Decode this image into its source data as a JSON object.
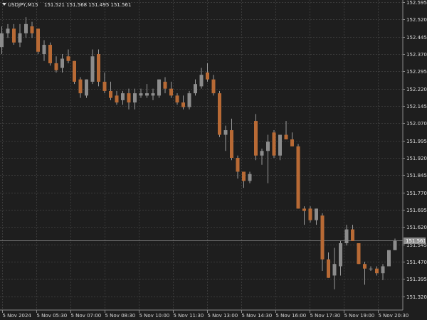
{
  "header": {
    "symbol": "USDJPY,M15",
    "ohlc": "151.521 151.568 151.495 151.561"
  },
  "colors": {
    "background": "#1e1e1e",
    "grid": "#3a3a3a",
    "axis": "#8a8a8a",
    "bull": "#8c8c8c",
    "bear": "#b86a35",
    "wick": "#9a9a9a",
    "price_tag_bg": "#8f8f8f"
  },
  "chart_data": {
    "type": "candlestick",
    "title": "",
    "grid": true,
    "ylim": [
      151.285,
      152.595
    ],
    "y_ticks": [
      "152.595",
      "152.520",
      "152.445",
      "152.370",
      "152.295",
      "152.220",
      "152.145",
      "152.070",
      "151.995",
      "151.920",
      "151.845",
      "151.770",
      "151.695",
      "151.620",
      "151.545",
      "151.470",
      "151.395",
      "151.320"
    ],
    "x_ticks": [
      "5 Nov 2024",
      "5 Nov 05:30",
      "5 Nov 07:00",
      "5 Nov 08:30",
      "5 Nov 10:00",
      "5 Nov 11:30",
      "5 Nov 13:00",
      "5 Nov 14:30",
      "5 Nov 16:00",
      "5 Nov 17:30",
      "5 Nov 19:00",
      "5 Nov 20:30"
    ],
    "current_price": "151.561",
    "candles": [
      {
        "o": 152.4,
        "h": 152.49,
        "l": 152.37,
        "c": 152.46
      },
      {
        "o": 152.46,
        "h": 152.5,
        "l": 152.44,
        "c": 152.48
      },
      {
        "o": 152.48,
        "h": 152.5,
        "l": 152.41,
        "c": 152.42
      },
      {
        "o": 152.42,
        "h": 152.5,
        "l": 152.4,
        "c": 152.46
      },
      {
        "o": 152.46,
        "h": 152.53,
        "l": 152.44,
        "c": 152.5
      },
      {
        "o": 152.49,
        "h": 152.51,
        "l": 152.44,
        "c": 152.46
      },
      {
        "o": 152.48,
        "h": 152.48,
        "l": 152.37,
        "c": 152.38
      },
      {
        "o": 152.37,
        "h": 152.43,
        "l": 152.34,
        "c": 152.41
      },
      {
        "o": 152.41,
        "h": 152.42,
        "l": 152.32,
        "c": 152.33
      },
      {
        "o": 152.33,
        "h": 152.36,
        "l": 152.29,
        "c": 152.3
      },
      {
        "o": 152.31,
        "h": 152.37,
        "l": 152.29,
        "c": 152.35
      },
      {
        "o": 152.36,
        "h": 152.39,
        "l": 152.33,
        "c": 152.34
      },
      {
        "o": 152.34,
        "h": 152.34,
        "l": 152.24,
        "c": 152.25
      },
      {
        "o": 152.26,
        "h": 152.27,
        "l": 152.18,
        "c": 152.2
      },
      {
        "o": 152.19,
        "h": 152.26,
        "l": 152.18,
        "c": 152.26
      },
      {
        "o": 152.25,
        "h": 152.39,
        "l": 152.24,
        "c": 152.36
      },
      {
        "o": 152.37,
        "h": 152.39,
        "l": 152.23,
        "c": 152.25
      },
      {
        "o": 152.25,
        "h": 152.29,
        "l": 152.2,
        "c": 152.21
      },
      {
        "o": 152.21,
        "h": 152.25,
        "l": 152.17,
        "c": 152.18
      },
      {
        "o": 152.19,
        "h": 152.21,
        "l": 152.15,
        "c": 152.16
      },
      {
        "o": 152.17,
        "h": 152.21,
        "l": 152.15,
        "c": 152.2
      },
      {
        "o": 152.2,
        "h": 152.22,
        "l": 152.13,
        "c": 152.16
      },
      {
        "o": 152.16,
        "h": 152.22,
        "l": 152.13,
        "c": 152.2
      },
      {
        "o": 152.19,
        "h": 152.22,
        "l": 152.18,
        "c": 152.2
      },
      {
        "o": 152.19,
        "h": 152.24,
        "l": 152.18,
        "c": 152.2
      },
      {
        "o": 152.19,
        "h": 152.22,
        "l": 152.17,
        "c": 152.2
      },
      {
        "o": 152.19,
        "h": 152.26,
        "l": 152.18,
        "c": 152.26
      },
      {
        "o": 152.25,
        "h": 152.27,
        "l": 152.2,
        "c": 152.22
      },
      {
        "o": 152.22,
        "h": 152.25,
        "l": 152.18,
        "c": 152.19
      },
      {
        "o": 152.19,
        "h": 152.2,
        "l": 152.15,
        "c": 152.16
      },
      {
        "o": 152.16,
        "h": 152.19,
        "l": 152.13,
        "c": 152.14
      },
      {
        "o": 152.14,
        "h": 152.21,
        "l": 152.13,
        "c": 152.2
      },
      {
        "o": 152.2,
        "h": 152.26,
        "l": 152.19,
        "c": 152.24
      },
      {
        "o": 152.23,
        "h": 152.31,
        "l": 152.22,
        "c": 152.28
      },
      {
        "o": 152.29,
        "h": 152.33,
        "l": 152.25,
        "c": 152.26
      },
      {
        "o": 152.26,
        "h": 152.28,
        "l": 152.19,
        "c": 152.2
      },
      {
        "o": 152.2,
        "h": 152.21,
        "l": 152.01,
        "c": 152.02
      },
      {
        "o": 152.02,
        "h": 152.06,
        "l": 151.95,
        "c": 152.04
      },
      {
        "o": 152.04,
        "h": 152.09,
        "l": 151.91,
        "c": 151.92
      },
      {
        "o": 151.92,
        "h": 151.93,
        "l": 151.83,
        "c": 151.86
      },
      {
        "o": 151.86,
        "h": 151.86,
        "l": 151.79,
        "c": 151.82
      },
      {
        "o": 151.82,
        "h": 151.86,
        "l": 151.81,
        "c": 151.85
      },
      {
        "o": 152.08,
        "h": 152.11,
        "l": 151.91,
        "c": 151.93
      },
      {
        "o": 151.93,
        "h": 151.96,
        "l": 151.89,
        "c": 151.95
      },
      {
        "o": 151.95,
        "h": 152.02,
        "l": 151.81,
        "c": 151.99
      },
      {
        "o": 152.03,
        "h": 152.04,
        "l": 151.92,
        "c": 151.93
      },
      {
        "o": 151.93,
        "h": 152.02,
        "l": 151.91,
        "c": 152.02
      },
      {
        "o": 152.02,
        "h": 152.08,
        "l": 152.0,
        "c": 152.0
      },
      {
        "o": 152.0,
        "h": 152.03,
        "l": 151.97,
        "c": 151.97
      },
      {
        "o": 151.97,
        "h": 151.98,
        "l": 151.7,
        "c": 151.7
      },
      {
        "o": 151.7,
        "h": 151.71,
        "l": 151.63,
        "c": 151.69
      },
      {
        "o": 151.7,
        "h": 151.71,
        "l": 151.64,
        "c": 151.65
      },
      {
        "o": 151.65,
        "h": 151.7,
        "l": 151.63,
        "c": 151.7
      },
      {
        "o": 151.67,
        "h": 151.68,
        "l": 151.43,
        "c": 151.48
      },
      {
        "o": 151.48,
        "h": 151.51,
        "l": 151.4,
        "c": 151.4
      },
      {
        "o": 151.41,
        "h": 151.53,
        "l": 151.35,
        "c": 151.46
      },
      {
        "o": 151.45,
        "h": 151.56,
        "l": 151.41,
        "c": 151.55
      },
      {
        "o": 151.55,
        "h": 151.63,
        "l": 151.54,
        "c": 151.61
      },
      {
        "o": 151.61,
        "h": 151.63,
        "l": 151.56,
        "c": 151.56
      },
      {
        "o": 151.55,
        "h": 151.55,
        "l": 151.46,
        "c": 151.46
      },
      {
        "o": 151.46,
        "h": 151.47,
        "l": 151.37,
        "c": 151.44
      },
      {
        "o": 151.44,
        "h": 151.45,
        "l": 151.43,
        "c": 151.44
      },
      {
        "o": 151.44,
        "h": 151.45,
        "l": 151.41,
        "c": 151.42
      },
      {
        "o": 151.42,
        "h": 151.46,
        "l": 151.39,
        "c": 151.45
      },
      {
        "o": 151.45,
        "h": 151.52,
        "l": 151.45,
        "c": 151.52
      },
      {
        "o": 151.52,
        "h": 151.57,
        "l": 151.52,
        "c": 151.56
      }
    ]
  }
}
